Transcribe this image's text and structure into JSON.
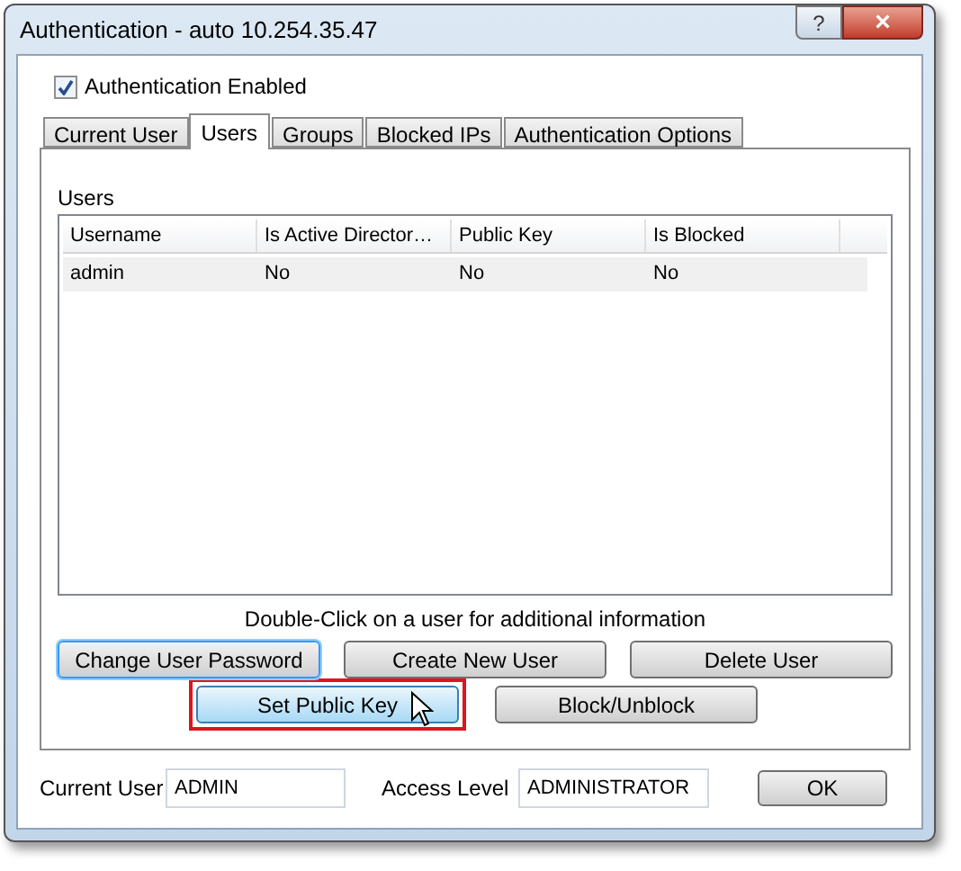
{
  "window": {
    "title": "Authentication - auto 10.254.35.47",
    "help": "?",
    "close": "×"
  },
  "auth_enabled": {
    "label": "Authentication Enabled",
    "checked": true
  },
  "tabs": [
    {
      "label": "Current User",
      "selected": false
    },
    {
      "label": "Users",
      "selected": true
    },
    {
      "label": "Groups",
      "selected": false
    },
    {
      "label": "Blocked IPs",
      "selected": false
    },
    {
      "label": "Authentication Options",
      "selected": false
    }
  ],
  "users": {
    "label": "Users",
    "columns": [
      "Username",
      "Is Active Director…",
      "Public Key",
      "Is Blocked"
    ],
    "rows": [
      [
        "admin",
        "No",
        "No",
        "No"
      ]
    ]
  },
  "hint": "Double-Click on a user for additional information",
  "buttons": [
    [
      {
        "label": "Change User Password",
        "focused": true,
        "hovered": false,
        "highlighted": false
      },
      {
        "label": "Create New User",
        "focused": false,
        "hovered": false,
        "highlighted": false
      },
      {
        "label": "Delete User",
        "focused": false,
        "hovered": false,
        "highlighted": false
      }
    ],
    [
      {
        "label": "Set Public Key",
        "focused": false,
        "hovered": true,
        "highlighted": true
      },
      {
        "label": "Block/Unblock",
        "focused": false,
        "hovered": false,
        "highlighted": false
      }
    ]
  ],
  "current_user": {
    "label": "Current User",
    "value": "ADMIN"
  },
  "access_level": {
    "label": "Access Level",
    "value": "ADMINISTRATOR"
  },
  "ok": "OK"
}
